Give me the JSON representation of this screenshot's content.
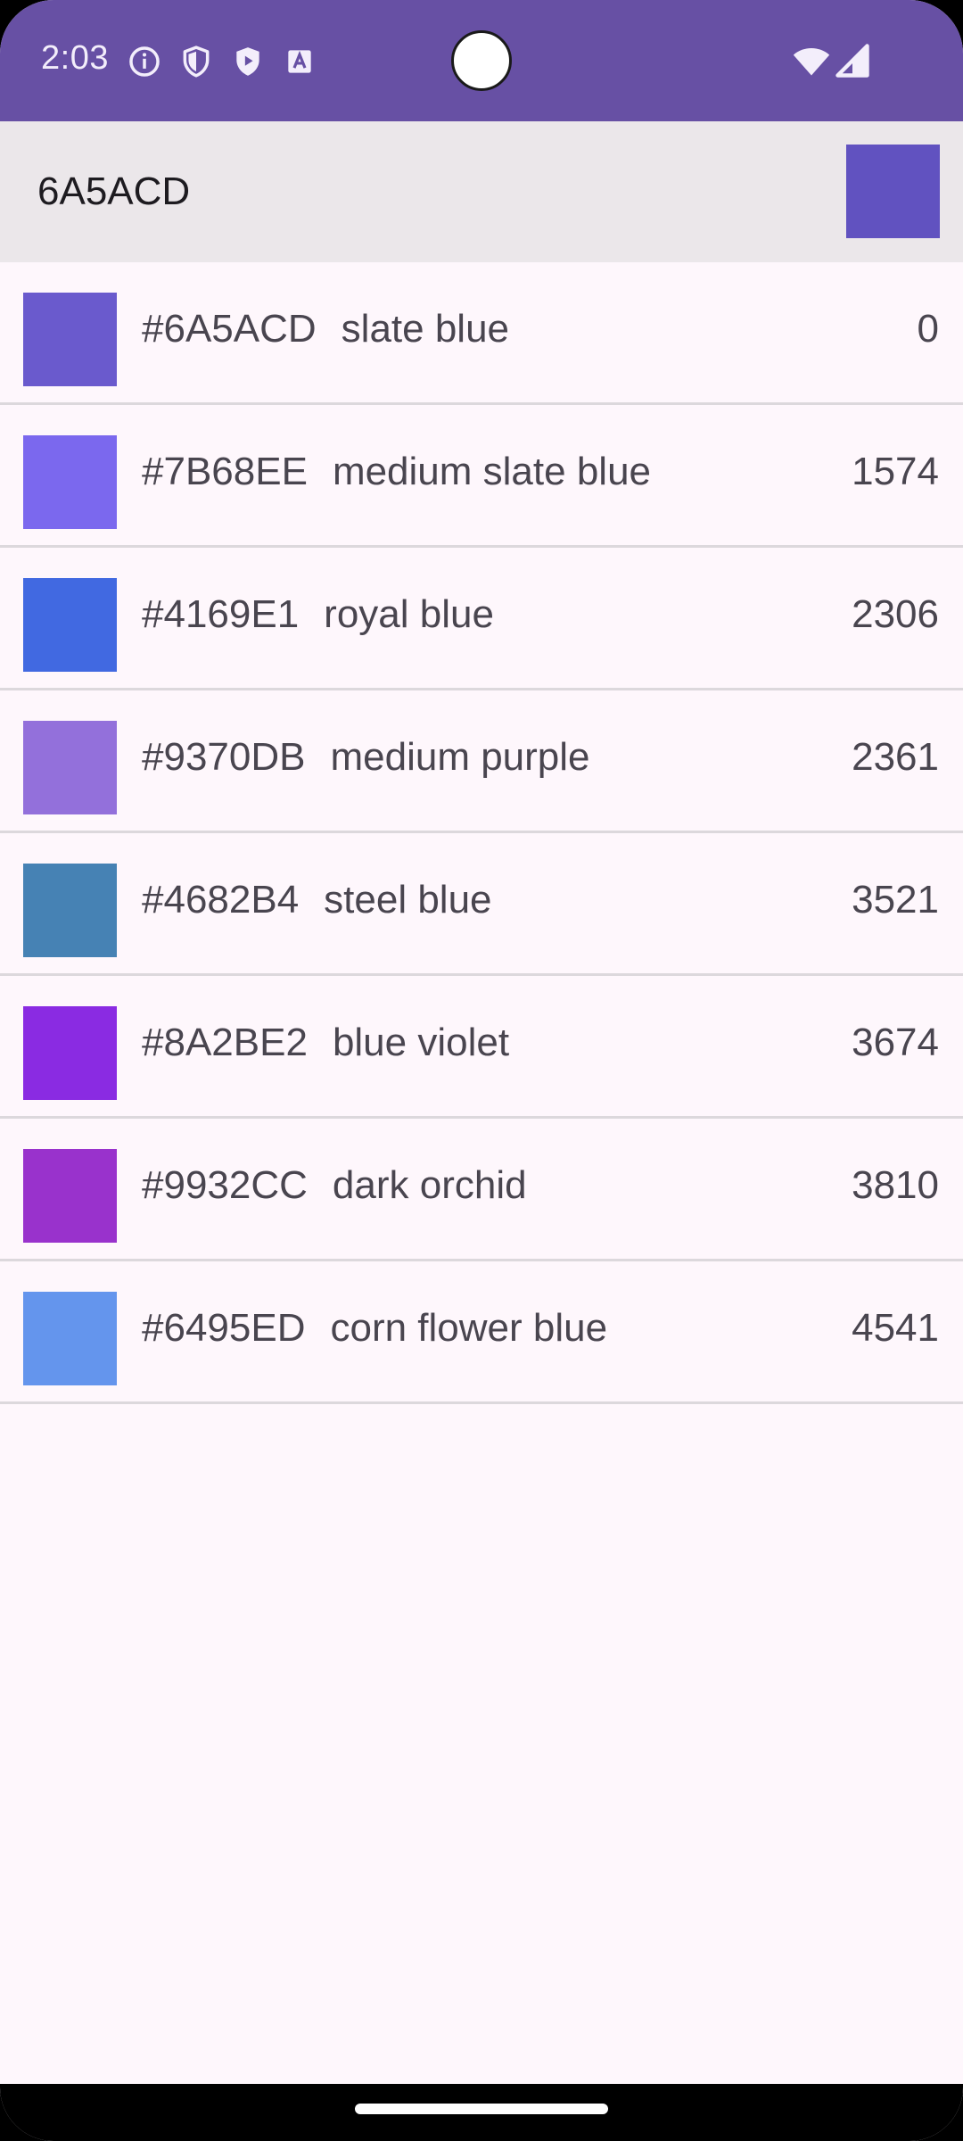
{
  "status_bar": {
    "time": "2:03",
    "icons": [
      "info-icon",
      "shield-icon",
      "play-protect-icon",
      "font-a-icon",
      "wifi-icon",
      "cell-signal-icon"
    ],
    "background_color": "#6750a4"
  },
  "input": {
    "value": "6A5ACD",
    "preview_color": "#6152c0"
  },
  "colors": [
    {
      "hex": "#6A5ACD",
      "name": "slate blue",
      "distance": "0",
      "swatch": "#6a5acd"
    },
    {
      "hex": "#7B68EE",
      "name": "medium slate blue",
      "distance": "1574",
      "swatch": "#7b68ee"
    },
    {
      "hex": "#4169E1",
      "name": "royal blue",
      "distance": "2306",
      "swatch": "#4169e1"
    },
    {
      "hex": "#9370DB",
      "name": "medium purple",
      "distance": "2361",
      "swatch": "#9370db"
    },
    {
      "hex": "#4682B4",
      "name": "steel blue",
      "distance": "3521",
      "swatch": "#4682b4"
    },
    {
      "hex": "#8A2BE2",
      "name": "blue violet",
      "distance": "3674",
      "swatch": "#8a2be2"
    },
    {
      "hex": "#9932CC",
      "name": "dark orchid",
      "distance": "3810",
      "swatch": "#9932cc"
    },
    {
      "hex": "#6495ED",
      "name": "corn flower blue",
      "distance": "4541",
      "swatch": "#6495ed"
    }
  ]
}
